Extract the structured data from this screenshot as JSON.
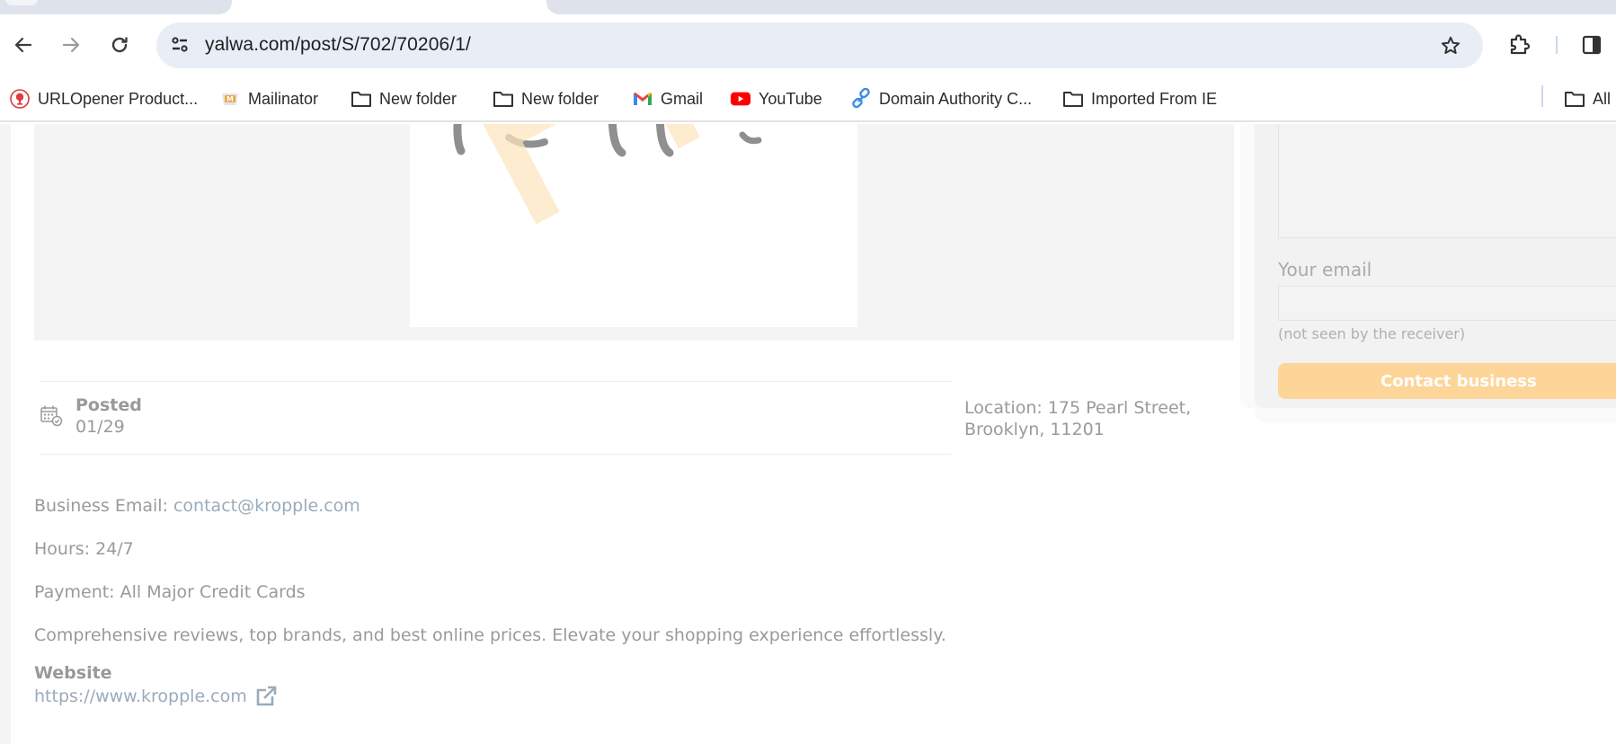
{
  "browser": {
    "url": "yalwa.com/post/S/702/70206/1/",
    "bookmarks": [
      {
        "label": "URLOpener Product...",
        "icon": "urlopener-icon"
      },
      {
        "label": "Mailinator",
        "icon": "mailinator-icon"
      },
      {
        "label": "New folder",
        "icon": "folder-icon"
      },
      {
        "label": "New folder",
        "icon": "folder-icon"
      },
      {
        "label": "Gmail",
        "icon": "gmail-icon"
      },
      {
        "label": "YouTube",
        "icon": "youtube-icon"
      },
      {
        "label": "Domain Authority C...",
        "icon": "link-icon"
      },
      {
        "label": "Imported From IE",
        "icon": "folder-icon"
      }
    ],
    "all_bookmarks_label": "All"
  },
  "gallery": {
    "watermark": "Preview"
  },
  "listing": {
    "posted_label": "Posted",
    "posted_date": "01/29",
    "location_line1": "Location: 175 Pearl Street,",
    "location_line2": "Brooklyn, 11201",
    "email_label": "Business Email: ",
    "email_value": "contact@kropple.com",
    "hours": "Hours: 24/7",
    "payment": "Payment: All Major Credit Cards",
    "description": "Comprehensive reviews, top brands, and best online prices. Elevate your shopping experience effortlessly.",
    "website_label": "Website",
    "website_url": "https://www.kropple.com"
  },
  "contact": {
    "email_label": "Your email",
    "email_value": "",
    "email_hint": "(not seen by the receiver)",
    "button_label": "Contact business"
  },
  "colors": {
    "accent_button": "#fdd599",
    "link": "#9aabba",
    "text_muted": "#9a9a9a",
    "watermark": "#fde5bd"
  }
}
